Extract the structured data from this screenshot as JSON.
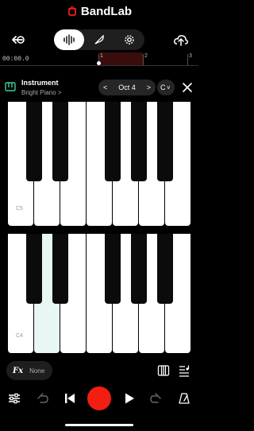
{
  "app": {
    "brand_name": "BandLab",
    "accent": "#f21e12"
  },
  "icons": {
    "brand_logo": "bandlab-logo-icon",
    "back": "undo-arrow-icon",
    "audio_mode": "waveform-icon",
    "edit_mode": "quill-icon",
    "settings": "gear-icon",
    "upload": "cloud-upload-icon",
    "instrument": "piano-icon",
    "close": "close-icon",
    "pianokeys": "piano-keys-icon",
    "notes": "music-notes-icon",
    "mixer": "sliders-icon",
    "undo": "undo-icon",
    "skip_back": "skip-to-start-icon",
    "record": "record-icon",
    "play": "play-icon",
    "redo": "redo-icon",
    "metronome": "metronome-icon"
  },
  "timeline": {
    "time_readout": "00:00.0",
    "ruler_labels": [
      "1",
      "2",
      "3"
    ]
  },
  "instrument": {
    "title": "Instrument",
    "preset": "Bright Piano",
    "preset_chevron": ">",
    "octave": "Oct 4",
    "octave_prev": "<",
    "octave_next": ">",
    "key": "C",
    "key_chevron": "v"
  },
  "keyboard": {
    "upper_label": "C5",
    "lower_label": "C4",
    "pressed_key_color": "#e8f7f4"
  },
  "fx": {
    "label": "Fx",
    "value": "None"
  }
}
